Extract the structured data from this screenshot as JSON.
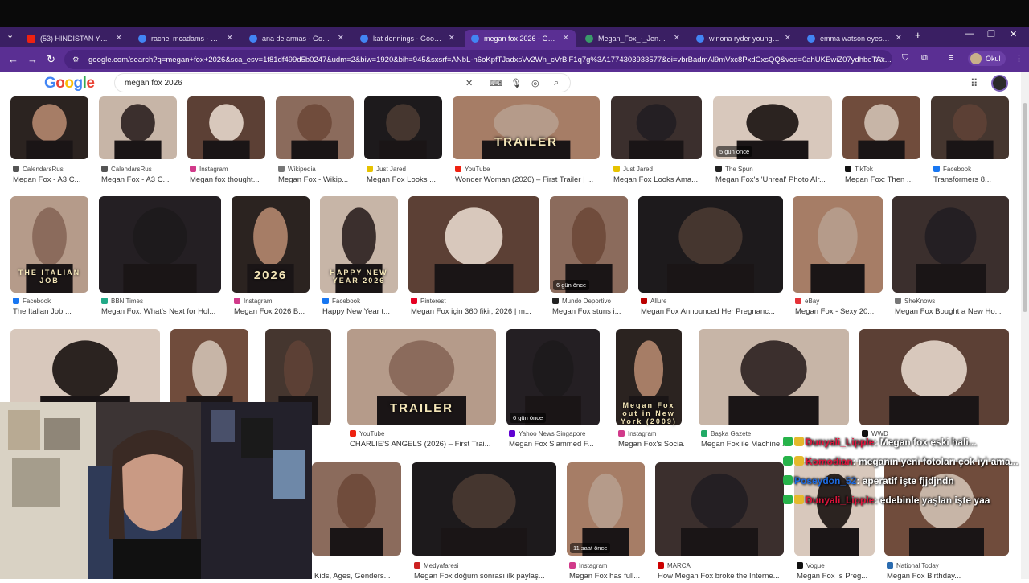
{
  "browser": {
    "tabs": [
      {
        "title": "(53) HİNDİSTAN YOLCULU",
        "active": false
      },
      {
        "title": "rachel mcadams - Google",
        "active": false
      },
      {
        "title": "ana de armas - Google'da",
        "active": false
      },
      {
        "title": "kat dennings - Google'da",
        "active": false
      },
      {
        "title": "megan fox 2026 - Google",
        "active": true
      },
      {
        "title": "Megan_Fox_-_Jennifer's_B",
        "active": false
      },
      {
        "title": "winona ryder young - Go",
        "active": false
      },
      {
        "title": "emma watson eyes - Goo",
        "active": false
      }
    ],
    "url": "google.com/search?q=megan+fox+2026&sca_esv=1f81df499d5b0247&udm=2&biw=1920&bih=945&sxsrf=ANbL-n6oKpfTJadxsVv2Wn_cVrBiF1q7g%3A1774303933577&ei=vbrBadmAl9mVxc8PxdCxsQQ&ved=0ahUKEwiZ07ydhbeTAx...",
    "profile_label": "Okul"
  },
  "google": {
    "logo": "Google",
    "query": "megan fox 2026"
  },
  "rows": [
    [
      {
        "source": "CalendarsRus",
        "title": "Megan Fox - A3 C...",
        "badge": ""
      },
      {
        "source": "CalendarsRus",
        "title": "Megan Fox - A3 C...",
        "badge": ""
      },
      {
        "source": "Instagram",
        "title": "Megan fox thought...",
        "badge": ""
      },
      {
        "source": "Wikipedia",
        "title": "Megan Fox - Wikip...",
        "badge": ""
      },
      {
        "source": "Just Jared",
        "title": "Megan Fox Looks ...",
        "badge": ""
      },
      {
        "source": "YouTube",
        "title": "Wonder Woman (2026) – First Trailer | ...",
        "badge": "",
        "overlay": "TRAILER"
      },
      {
        "source": "Just Jared",
        "title": "Megan Fox Looks Ama...",
        "badge": ""
      },
      {
        "source": "The Spun",
        "title": "Megan Fox's 'Unreal' Photo Alr...",
        "badge": "5 gün önce"
      },
      {
        "source": "TikTok",
        "title": "Megan Fox: Then ...",
        "badge": ""
      },
      {
        "source": "Facebook",
        "title": "Transformers 8...",
        "badge": ""
      }
    ],
    [
      {
        "source": "Facebook",
        "title": "The Italian Job ...",
        "badge": "",
        "overlay": "THE ITALIAN JOB"
      },
      {
        "source": "BBN Times",
        "title": "Megan Fox: What's Next for Hol...",
        "badge": ""
      },
      {
        "source": "Instagram",
        "title": "Megan Fox 2026 B...",
        "badge": "",
        "overlay": "2026"
      },
      {
        "source": "Facebook",
        "title": "Happy New Year t...",
        "badge": "",
        "overlay": "HAPPY NEW YEAR 2026"
      },
      {
        "source": "Pinterest",
        "title": "Megan Fox için 360 fikir, 2026 | m...",
        "badge": ""
      },
      {
        "source": "Mundo Deportivo",
        "title": "Megan Fox stuns i...",
        "badge": "6 gün önce"
      },
      {
        "source": "Allure",
        "title": "Megan Fox Announced Her Pregnanc...",
        "badge": ""
      },
      {
        "source": "eBay",
        "title": "Megan Fox - Sexy 20...",
        "badge": ""
      },
      {
        "source": "SheKnows",
        "title": "Megan Fox Bought a New Ho...",
        "badge": ""
      }
    ],
    [
      {
        "source": "",
        "title": "",
        "badge": ""
      },
      {
        "source": "",
        "title": "",
        "badge": ""
      },
      {
        "source": "",
        "title": "...an",
        "badge": ""
      },
      {
        "source": "YouTube",
        "title": "CHARLIE'S ANGELS (2026) – First Trai...",
        "badge": "",
        "overlay": "TRAILER"
      },
      {
        "source": "Yahoo News Singapore",
        "title": "Megan Fox Slammed F...",
        "badge": "6 gün önce"
      },
      {
        "source": "Instagram",
        "title": "Megan Fox's Socia...",
        "badge": "",
        "overlay": "Megan Fox out in New York (2009)"
      },
      {
        "source": "Başka Gazete",
        "title": "Megan Fox ile Machine ...",
        "badge": ""
      },
      {
        "source": "WWD",
        "title": "",
        "badge": ""
      }
    ],
    [
      {
        "source": "",
        "title": "Kids, Ages, Genders...",
        "badge": ""
      },
      {
        "source": "Medyafaresi",
        "title": "Megan Fox doğum sonrası ilk paylaş...",
        "badge": ""
      },
      {
        "source": "Instagram",
        "title": "Megan Fox has full...",
        "badge": "11 saat önce"
      },
      {
        "source": "MARCA",
        "title": "How Megan Fox broke the Interne...",
        "badge": ""
      },
      {
        "source": "Vogue",
        "title": "Megan Fox Is Preg...",
        "badge": ""
      },
      {
        "source": "National Today",
        "title": "Megan Fox Birthday...",
        "badge": ""
      }
    ]
  ],
  "chat": [
    {
      "user": "Dunyali_Lipple",
      "msg": ": Megan fox eski hali...",
      "blue": false
    },
    {
      "user": "Komodian",
      "msg": ": meganın yeni fotoları çok iyi ama...",
      "blue": false
    },
    {
      "user": "Poseydon_52",
      "msg": ": aperatif işte fjjdjndn",
      "blue": true
    },
    {
      "user": "Dunyali_Lipple",
      "msg": ": edebinle yaşlan işte yaa",
      "blue": false
    }
  ]
}
